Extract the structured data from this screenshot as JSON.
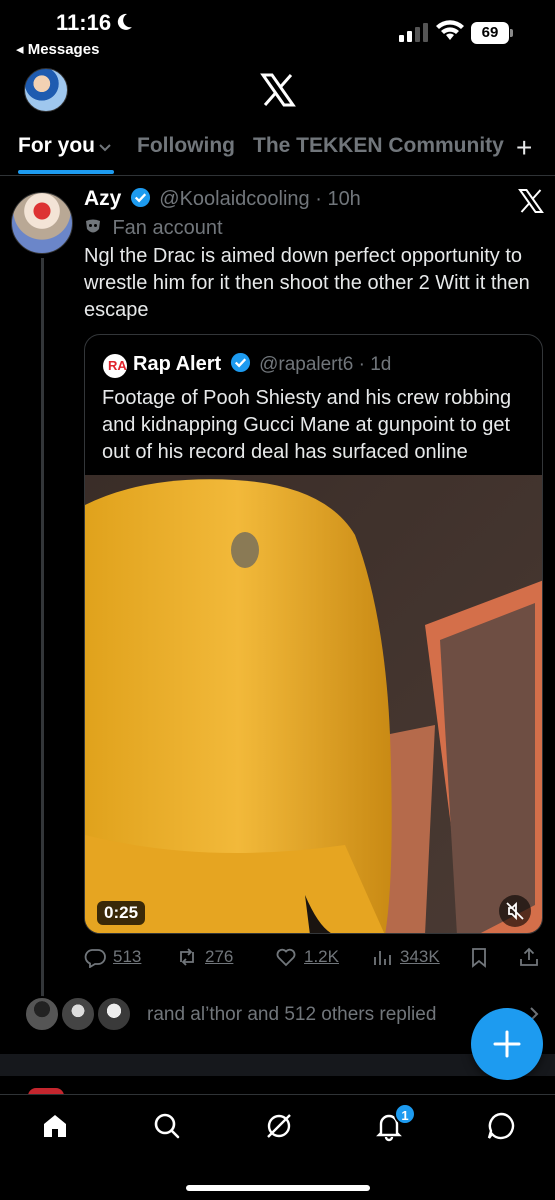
{
  "status_bar": {
    "time": "11:16",
    "back_label": "◂ Messages",
    "battery": "69"
  },
  "tabs": [
    {
      "label": "For you",
      "active": true
    },
    {
      "label": "Following",
      "active": false
    },
    {
      "label": "The TEKKEN Community",
      "active": false
    }
  ],
  "tab_add": "+",
  "post": {
    "author_name": "Azy",
    "handle_time": "@Koolaidcooling · 10h",
    "fan_label": "Fan account",
    "text": "Ngl the Drac is aimed down perfect opportunity to wrestle him for it then shoot the other 2 Witt it then escape",
    "quote": {
      "avatar_text": "RA",
      "author_name": "Rap Alert",
      "handle_time": "@rapalert6 · 1d",
      "text": "Footage of Pooh Shiesty and his crew robbing and kidnapping Gucci Mane at gunpoint to get out of his record deal has surfaced online",
      "video_duration": "0:25"
    },
    "actions": {
      "replies": "513",
      "reposts": "276",
      "likes": "1.2K",
      "views": "343K"
    },
    "replies_summary": "rand al’thor and 512 others replied"
  },
  "notifications_badge": "1",
  "colors": {
    "accent": "#1d9bf0",
    "background": "#000000",
    "muted": "#71767b"
  }
}
